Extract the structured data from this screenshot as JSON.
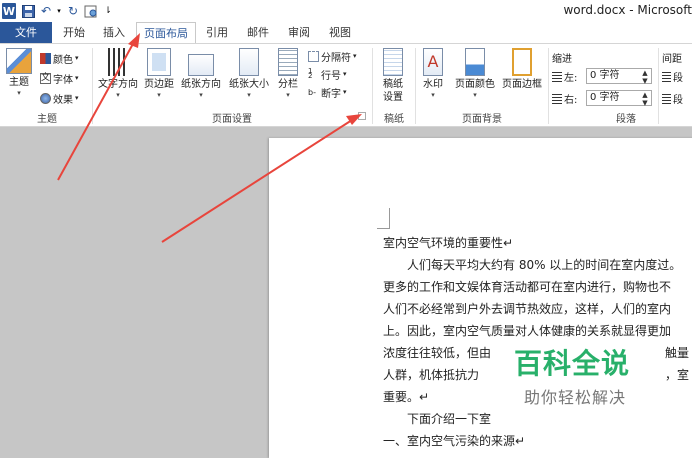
{
  "title_bar": {
    "title": "word.docx - Microsoft"
  },
  "tabs": [
    "文件",
    "开始",
    "插入",
    "页面布局",
    "引用",
    "邮件",
    "审阅",
    "视图"
  ],
  "ribbon": {
    "themes": {
      "themes_btn": "主题",
      "colors": "颜色",
      "fonts": "字体",
      "effects": "效果",
      "group_label": "主题"
    },
    "page_setup": {
      "text_direction": "文字方向",
      "margins": "页边距",
      "orientation": "纸张方向",
      "size": "纸张大小",
      "columns": "分栏",
      "breaks": "分隔符",
      "line_numbers": "行号",
      "hyphenation": "断字",
      "group_label": "页面设置"
    },
    "draft": {
      "draft_settings_line1": "稿纸",
      "draft_settings_line2": "设置",
      "group_label": "稿纸"
    },
    "page_background": {
      "watermark": "水印",
      "page_color": "页面颜色",
      "page_borders": "页面边框",
      "group_label": "页面背景"
    },
    "paragraph": {
      "indent_label": "缩进",
      "left_label": "左:",
      "left_value": "0 字符",
      "right_label": "右:",
      "right_value": "0 字符",
      "spacing_label": "间距",
      "before_label": "段",
      "after_label": "段",
      "group_label": "段落"
    }
  },
  "document": {
    "lines": [
      "室内空气环境的重要性↵",
      "　　人们每天平均大约有 80% 以上的时间在室内度过。",
      "更多的工作和文娱体育活动都可在室内进行，购物也不",
      "人们不必经常到户外去调节热效应，这样，人们的室内",
      "上。因此，室内空气质量对人体健康的关系就显得更加",
      "浓度往往较低，但由",
      "人群，机体抵抗力",
      "重要。↵",
      "　　下面介绍一下室",
      "一、室内空气污染的来源↵"
    ],
    "frag_touch": "触量",
    "frag_room": "，室"
  },
  "watermark": {
    "title": "百科全说",
    "subtitle": "助你轻松解决"
  },
  "colors": {
    "file_tab": "#2b579a",
    "arrow": "#e8453c",
    "watermark_green": "#28b06a"
  }
}
